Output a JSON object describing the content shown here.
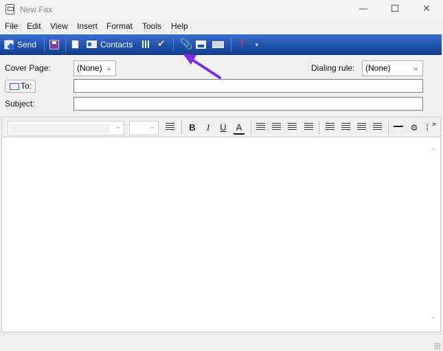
{
  "window": {
    "title": "New Fax"
  },
  "menu": [
    "File",
    "Edit",
    "View",
    "Insert",
    "Format",
    "Tools",
    "Help"
  ],
  "toolbar": {
    "send_label": "Send",
    "contacts_label": "Contacts"
  },
  "form": {
    "cover_page_label": "Cover Page:",
    "cover_page_value": "(None)",
    "dialing_rule_label": "Dialing rule:",
    "dialing_rule_value": "(None)",
    "to_label": "To:",
    "to_value": "",
    "subject_label": "Subject:",
    "subject_value": ""
  },
  "format_toolbar": {
    "font_value": "",
    "size_value": "",
    "bold": "B",
    "italic": "I",
    "underline": "U",
    "font_color": "A",
    "more": "»"
  },
  "icons": {
    "send": "send-icon",
    "save": "save-icon",
    "address_book": "address-book-icon",
    "contacts": "contacts-icon",
    "attach": "paperclip-icon",
    "picture": "insert-picture-icon",
    "scan": "scan-icon",
    "priority": "priority-icon"
  },
  "colors": {
    "toolbar_blue": "#1f4fa8",
    "annotation_arrow": "#7b2be0",
    "priority_red": "#e2312a"
  },
  "annotation": {
    "target": "attach-file-button"
  }
}
